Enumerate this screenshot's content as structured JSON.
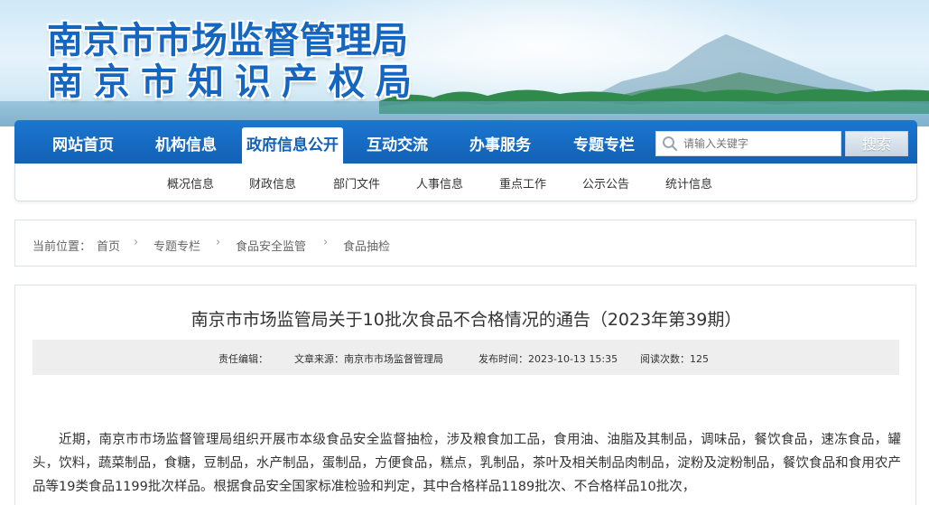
{
  "banner": {
    "title_line1": "南京市市场监督管理局",
    "title_line2": "南京市知识产权局"
  },
  "nav": {
    "items": [
      {
        "label": "网站首页",
        "active": false
      },
      {
        "label": "机构信息",
        "active": false
      },
      {
        "label": "政府信息公开",
        "active": true
      },
      {
        "label": "互动交流",
        "active": false
      },
      {
        "label": "办事服务",
        "active": false
      },
      {
        "label": "专题专栏",
        "active": false
      }
    ],
    "search": {
      "placeholder": "请输入关键字",
      "button_label": "搜索",
      "icon": "search-icon"
    },
    "sub_items": [
      "概况信息",
      "财政信息",
      "部门文件",
      "人事信息",
      "重点工作",
      "公示公告",
      "统计信息"
    ]
  },
  "breadcrumb": {
    "prefix": "当前位置：",
    "items": [
      "首页",
      "专题专栏",
      "食品安全监管",
      "食品抽检"
    ],
    "separator": "›"
  },
  "article": {
    "title": "南京市市场监管局关于10批次食品不合格情况的通告（2023年第39期）",
    "meta": {
      "editor": "责任编辑：",
      "source": "文章来源：南京市市场监督管理局",
      "date": "发布时间：2023-10-13 15:35",
      "views": "阅读次数：125"
    },
    "body": "近期，南京市市场监督管理局组织开展市本级食品安全监督抽检，涉及粮食加工品，食用油、油脂及其制品，调味品，餐饮食品，速冻食品，罐头，饮料，蔬菜制品，食糖，豆制品，水产制品，蛋制品，方便食品，糕点，乳制品，茶叶及相关制品肉制品，淀粉及淀粉制品，餐饮食品和食用农产品等19类食品1199批次样品。根据食品安全国家标准检验和判定，其中合格样品1189批次、不合格样品10批次，"
  },
  "colors": {
    "nav_blue": "#1261b5",
    "title_blue": "#1566c0",
    "meta_bg": "#eeeeee"
  }
}
